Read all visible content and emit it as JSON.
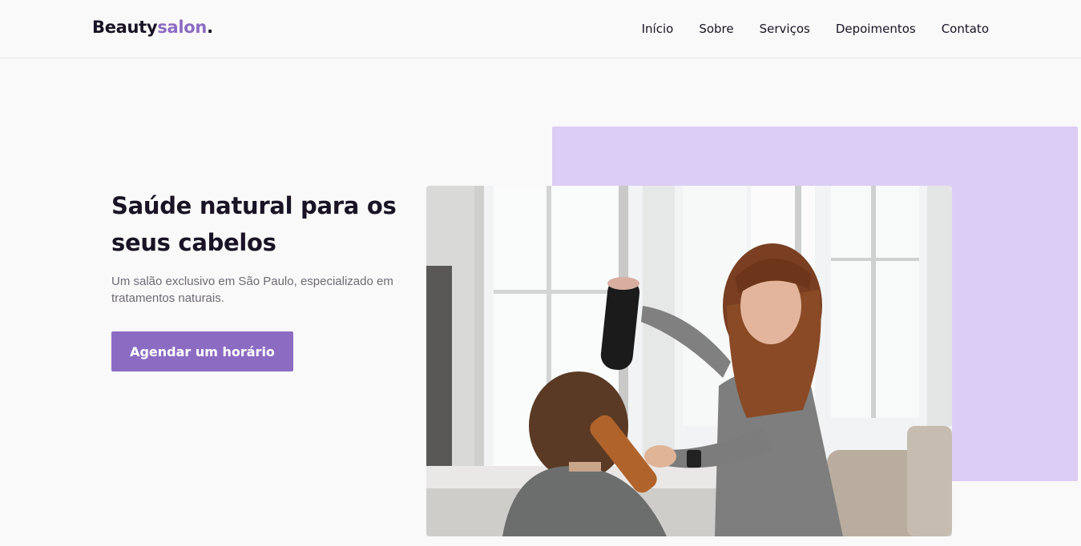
{
  "brand": {
    "part1": "Beauty",
    "part2": "salon",
    "part3": "."
  },
  "nav": {
    "items": [
      "Início",
      "Sobre",
      "Serviços",
      "Depoimentos",
      "Contato"
    ]
  },
  "hero": {
    "title": "Saúde natural para os seus cabelos",
    "subtitle": "Um salão exclusivo em São Paulo, especializado em tratamentos naturais.",
    "cta_label": "Agendar um horário"
  },
  "colors": {
    "accent": "#8c6cc3",
    "accent_light": "#dccdf4",
    "text_dark": "#1a1325",
    "text_muted": "#6e6a75",
    "background": "#f9f9f9"
  },
  "images": {
    "hero_photo": "hairdresser-blow-drying-client-photo"
  }
}
